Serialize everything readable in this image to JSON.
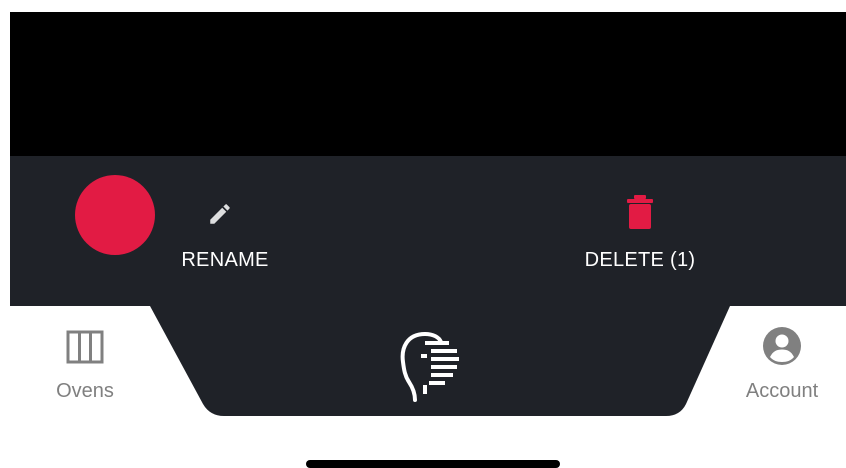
{
  "action_sheet": {
    "rename": {
      "label": "RENAME",
      "icon": "pencil-icon"
    },
    "delete": {
      "label": "DELETE (1)",
      "icon": "trash-icon"
    }
  },
  "tab_bar": {
    "ovens": {
      "label": "Ovens",
      "icon": "ovens-grid-icon"
    },
    "center": {
      "icon": "app-logo-face-icon"
    },
    "account": {
      "label": "Account",
      "icon": "account-icon"
    }
  },
  "colors": {
    "accent_red": "#e21b44",
    "sheet_bg": "#1f2228",
    "tab_bar_bg": "#1f2228",
    "tab_label": "#808080"
  }
}
